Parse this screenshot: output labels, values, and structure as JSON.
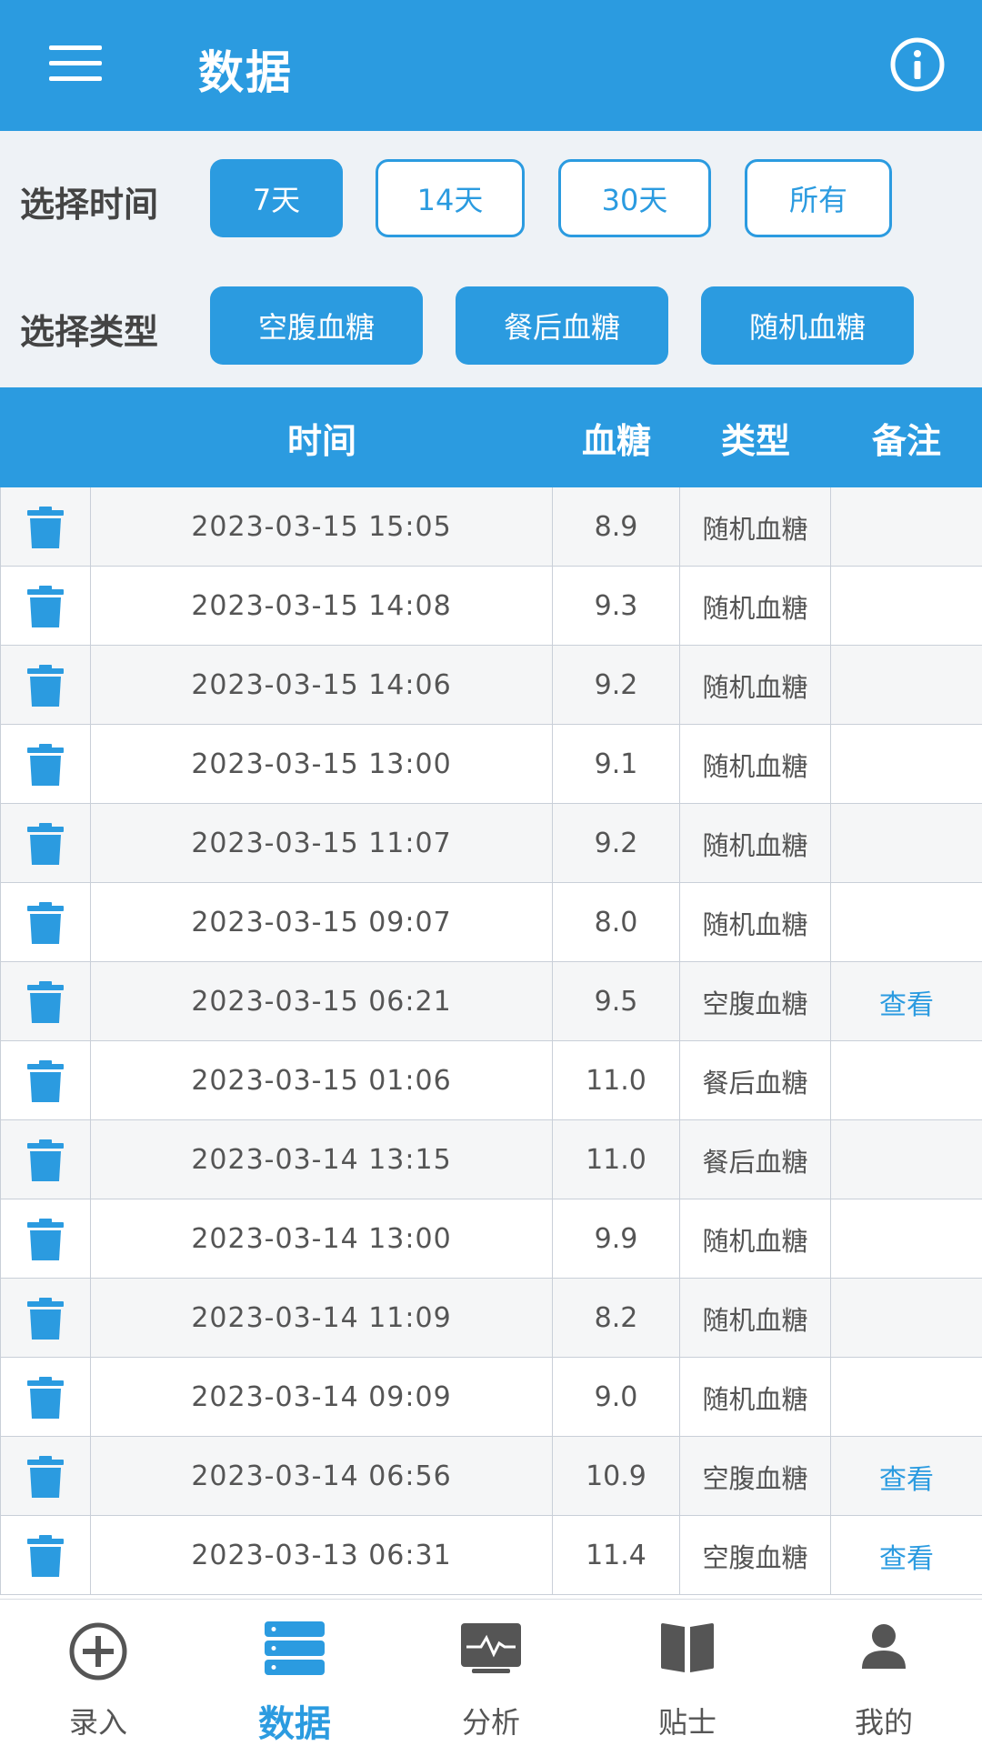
{
  "appbar": {
    "title": "数据"
  },
  "filters": {
    "time_label": "选择时间",
    "time_options": [
      {
        "label": "7天",
        "selected": true
      },
      {
        "label": "14天",
        "selected": false
      },
      {
        "label": "30天",
        "selected": false
      },
      {
        "label": "所有",
        "selected": false
      }
    ],
    "type_label": "选择类型",
    "type_options": [
      {
        "label": "空腹血糖",
        "selected": true
      },
      {
        "label": "餐后血糖",
        "selected": true
      },
      {
        "label": "随机血糖",
        "selected": true
      }
    ]
  },
  "table": {
    "headers": {
      "time": "时间",
      "value": "血糖",
      "type": "类型",
      "note": "备注"
    },
    "rows": [
      {
        "time": "2023-03-15 15:05",
        "value": "8.9",
        "type": "随机血糖",
        "note": ""
      },
      {
        "time": "2023-03-15 14:08",
        "value": "9.3",
        "type": "随机血糖",
        "note": ""
      },
      {
        "time": "2023-03-15 14:06",
        "value": "9.2",
        "type": "随机血糖",
        "note": ""
      },
      {
        "time": "2023-03-15 13:00",
        "value": "9.1",
        "type": "随机血糖",
        "note": ""
      },
      {
        "time": "2023-03-15 11:07",
        "value": "9.2",
        "type": "随机血糖",
        "note": ""
      },
      {
        "time": "2023-03-15 09:07",
        "value": "8.0",
        "type": "随机血糖",
        "note": ""
      },
      {
        "time": "2023-03-15 06:21",
        "value": "9.5",
        "type": "空腹血糖",
        "note": "查看"
      },
      {
        "time": "2023-03-15 01:06",
        "value": "11.0",
        "type": "餐后血糖",
        "note": ""
      },
      {
        "time": "2023-03-14 13:15",
        "value": "11.0",
        "type": "餐后血糖",
        "note": ""
      },
      {
        "time": "2023-03-14 13:00",
        "value": "9.9",
        "type": "随机血糖",
        "note": ""
      },
      {
        "time": "2023-03-14 11:09",
        "value": "8.2",
        "type": "随机血糖",
        "note": ""
      },
      {
        "time": "2023-03-14 09:09",
        "value": "9.0",
        "type": "随机血糖",
        "note": ""
      },
      {
        "time": "2023-03-14 06:56",
        "value": "10.9",
        "type": "空腹血糖",
        "note": "查看"
      },
      {
        "time": "2023-03-13 06:31",
        "value": "11.4",
        "type": "空腹血糖",
        "note": "查看"
      }
    ]
  },
  "bottom_nav": [
    {
      "label": "录入",
      "icon": "plus-circle-icon",
      "active": false
    },
    {
      "label": "数据",
      "icon": "database-icon",
      "active": true
    },
    {
      "label": "分析",
      "icon": "chart-monitor-icon",
      "active": false
    },
    {
      "label": "贴士",
      "icon": "book-icon",
      "active": false
    },
    {
      "label": "我的",
      "icon": "user-icon",
      "active": false
    }
  ],
  "colors": {
    "primary": "#2b9be0",
    "filter_bg": "#eef2f6",
    "text": "#555555"
  }
}
